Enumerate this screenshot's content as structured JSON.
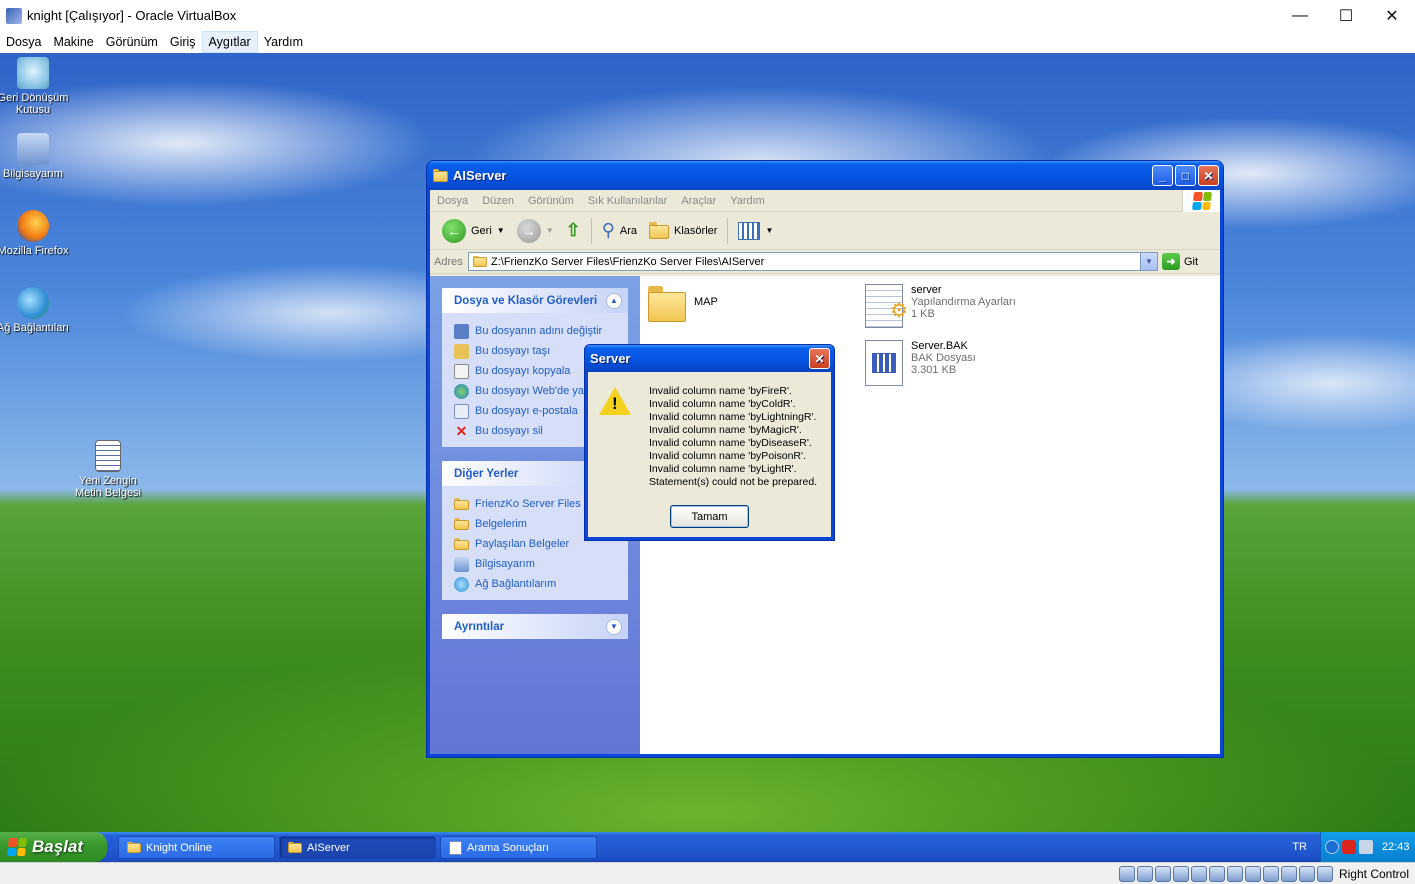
{
  "vbox": {
    "title": "knight [Çalışıyor] - Oracle VirtualBox",
    "menu": [
      "Dosya",
      "Makine",
      "Görünüm",
      "Giriş",
      "Aygıtlar",
      "Yardım"
    ],
    "status_label": "Right Control"
  },
  "desktop_icons": [
    {
      "label": "Geri Dönüşüm Kutusu",
      "icon": "recycle-bin-icon"
    },
    {
      "label": "Bilgisayarım",
      "icon": "my-computer-icon"
    },
    {
      "label": "Mozilla Firefox",
      "icon": "firefox-icon"
    },
    {
      "label": "Ağ Bağlantıları",
      "icon": "network-icon"
    },
    {
      "label": "Yeni Zengin Metin Belgesi",
      "icon": "rtf-document-icon"
    }
  ],
  "explorer": {
    "title": "AIServer",
    "menu": [
      "Dosya",
      "Düzen",
      "Görünüm",
      "Sık Kullanılanlar",
      "Araçlar",
      "Yardım"
    ],
    "toolbar": {
      "back": "Geri",
      "search": "Ara",
      "folders": "Klasörler"
    },
    "address": {
      "label": "Adres",
      "value": "Z:\\FrienzKo Server Files\\FrienzKo Server Files\\AIServer",
      "go": "Git"
    },
    "task_pane": {
      "file_tasks_title": "Dosya ve Klasör Görevleri",
      "file_tasks": [
        {
          "label": "Bu dosyanın adını değiştir",
          "icon": "rename-icon"
        },
        {
          "label": "Bu dosyayı taşı",
          "icon": "move-icon"
        },
        {
          "label": "Bu dosyayı kopyala",
          "icon": "copy-icon"
        },
        {
          "label": "Bu dosyayı Web'de yayımla",
          "icon": "publish-web-icon"
        },
        {
          "label": "Bu dosyayı e-postala",
          "icon": "email-icon"
        },
        {
          "label": "Bu dosyayı sil",
          "icon": "delete-icon"
        }
      ],
      "other_places_title": "Diğer Yerler",
      "other_places": [
        {
          "label": "FrienzKo Server Files",
          "icon": "folder-icon"
        },
        {
          "label": "Belgelerim",
          "icon": "my-documents-icon"
        },
        {
          "label": "Paylaşılan Belgeler",
          "icon": "shared-documents-icon"
        },
        {
          "label": "Bilgisayarım",
          "icon": "my-computer-icon"
        },
        {
          "label": "Ağ Bağlantılarım",
          "icon": "network-icon"
        }
      ],
      "details_title": "Ayrıntılar"
    },
    "files": [
      {
        "name": "MAP",
        "type": "",
        "size": "",
        "icon": "folder-icon"
      },
      {
        "name": "server",
        "type": "Yapılandırma Ayarları",
        "size": "1 KB",
        "icon": "config-file-icon"
      },
      {
        "name": "Server.BAK",
        "type": "BAK Dosyası",
        "size": "3.301 KB",
        "icon": "bak-file-icon"
      }
    ]
  },
  "dialog": {
    "title": "Server",
    "lines": [
      "Invalid column name 'byFireR'.",
      "Invalid column name 'byColdR'.",
      "Invalid column name 'byLightningR'.",
      "Invalid column name 'byMagicR'.",
      "Invalid column name 'byDiseaseR'.",
      "Invalid column name 'byPoisonR'.",
      "Invalid column name 'byLightR'.",
      "Statement(s) could not be prepared."
    ],
    "ok_label": "Tamam"
  },
  "taskbar": {
    "start_label": "Başlat",
    "buttons": [
      "Knight Online",
      "AIServer",
      "Arama Sonuçları"
    ],
    "language": "TR",
    "clock": "22:43"
  },
  "colors": {
    "xp_blue": "#0a46d8",
    "start_green": "#3a9a2e",
    "link_blue": "#215dc6"
  }
}
